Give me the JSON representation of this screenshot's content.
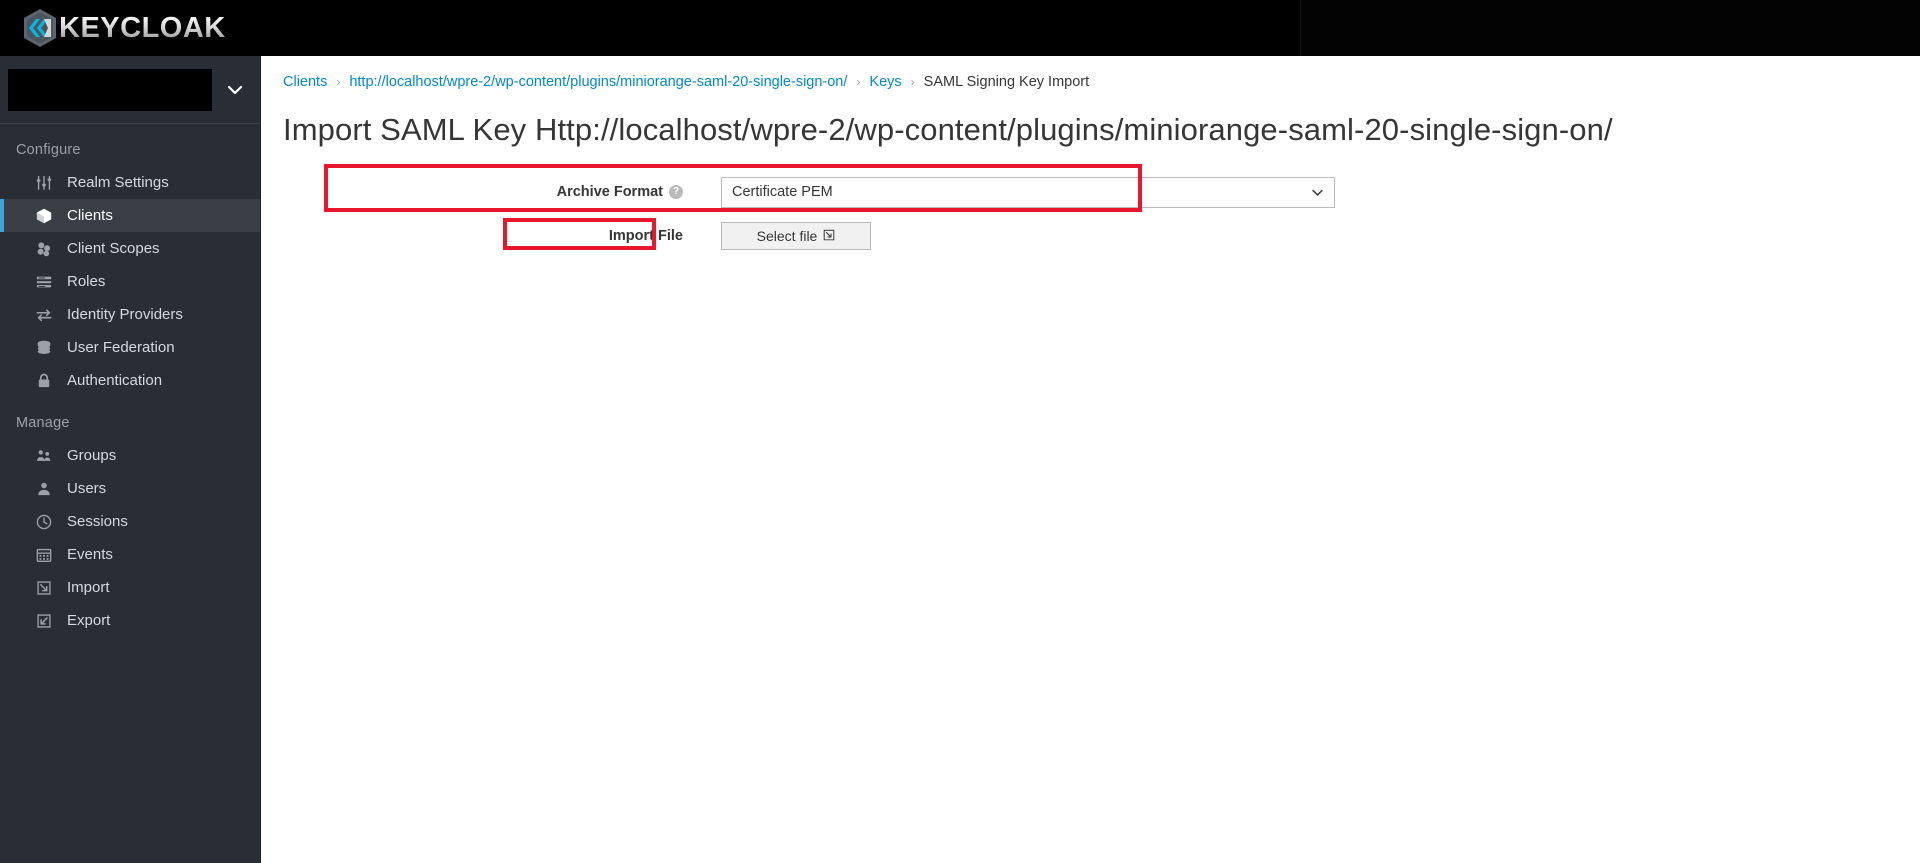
{
  "masthead": {
    "brand_name": "KEYCLOAK",
    "logo_icon": "keycloak-hexagon-logo"
  },
  "sidebar": {
    "realm_selector": {
      "value": "",
      "caret_icon": "chevron-down-icon"
    },
    "sections": [
      {
        "label": "Configure",
        "items": [
          {
            "label": "Realm Settings",
            "icon": "sliders-icon",
            "active": false
          },
          {
            "label": "Clients",
            "icon": "cube-icon",
            "active": true
          },
          {
            "label": "Client Scopes",
            "icon": "blocks-icon",
            "active": false
          },
          {
            "label": "Roles",
            "icon": "list-rows-icon",
            "active": false
          },
          {
            "label": "Identity Providers",
            "icon": "exchange-arrows-icon",
            "active": false
          },
          {
            "label": "User Federation",
            "icon": "database-icon",
            "active": false
          },
          {
            "label": "Authentication",
            "icon": "lock-icon",
            "active": false
          }
        ]
      },
      {
        "label": "Manage",
        "items": [
          {
            "label": "Groups",
            "icon": "users-group-icon",
            "active": false
          },
          {
            "label": "Users",
            "icon": "user-icon",
            "active": false
          },
          {
            "label": "Sessions",
            "icon": "clock-icon",
            "active": false
          },
          {
            "label": "Events",
            "icon": "calendar-icon",
            "active": false
          },
          {
            "label": "Import",
            "icon": "import-arrow-icon",
            "active": false
          },
          {
            "label": "Export",
            "icon": "export-arrow-icon",
            "active": false
          }
        ]
      }
    ]
  },
  "main": {
    "breadcrumb": {
      "items": [
        {
          "label": "Clients",
          "current": false
        },
        {
          "label": "http://localhost/wpre-2/wp-content/plugins/miniorange-saml-20-single-sign-on/",
          "current": false
        },
        {
          "label": "Keys",
          "current": false
        },
        {
          "label": "SAML Signing Key Import",
          "current": true
        }
      ],
      "separator": "›"
    },
    "page_title": "Import SAML Key Http://localhost/wpre-2/wp-content/plugins/miniorange-saml-20-single-sign-on/",
    "form": {
      "archive_format": {
        "label": "Archive Format",
        "help_icon": "question-circle-icon",
        "help_glyph": "?",
        "selected_value": "Certificate PEM",
        "caret_icon": "chevron-down-icon"
      },
      "import_file": {
        "label": "Import File",
        "button_label": "Select file",
        "button_icon": "file-upload-icon"
      }
    }
  },
  "colors": {
    "accent_blue": "#39a5dc",
    "link_blue": "#0088ce",
    "sidebar_bg": "#292e34",
    "sidebar_active_bg": "#393f44",
    "annotation_red": "#e8172a",
    "masthead_bg": "#000000"
  }
}
